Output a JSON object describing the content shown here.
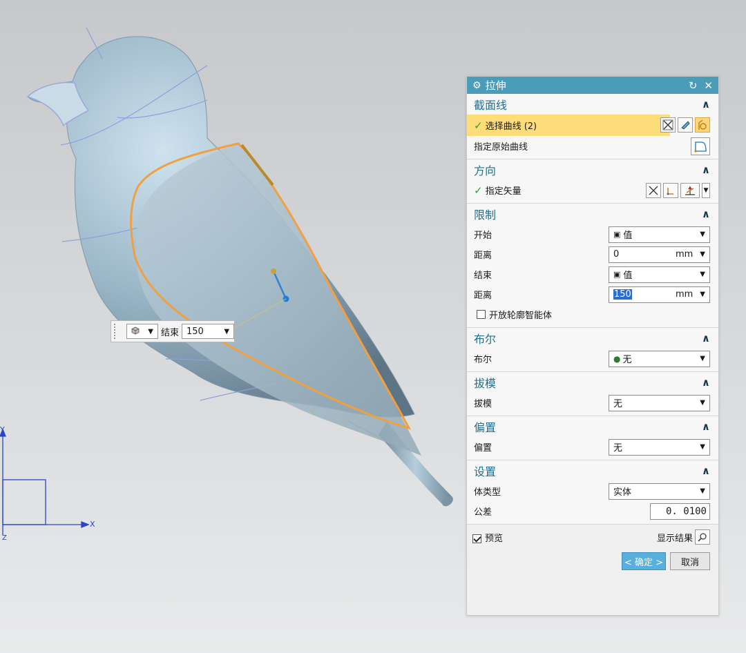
{
  "mini_toolbar": {
    "type_arrow": "▼",
    "label": "结束",
    "value": "150",
    "arrow": "▼"
  },
  "axes": {
    "x_label": "X",
    "y_label": "Y",
    "z_label": "Z"
  },
  "dialog": {
    "title": "拉伸",
    "reset_icon": "↻",
    "close_icon": "✕",
    "sections": {
      "section": {
        "header": "截面线",
        "select_curve": "选择曲线 (2)",
        "original_curve": "指定原始曲线"
      },
      "direction": {
        "header": "方向",
        "vector": "指定矢量"
      },
      "limits": {
        "header": "限制",
        "start_label": "开始",
        "start_value": "值",
        "start_distance_label": "距离",
        "start_distance": "0",
        "start_unit": "mm",
        "end_label": "结束",
        "end_value": "值",
        "end_distance_label": "距离",
        "end_distance": "150",
        "end_unit": "mm",
        "open_profile": "开放轮廓智能体"
      },
      "boolean": {
        "header": "布尔",
        "label": "布尔",
        "value": "无"
      },
      "draft": {
        "header": "拔模",
        "label": "拔模",
        "value": "无"
      },
      "offset": {
        "header": "偏置",
        "label": "偏置",
        "value": "无"
      },
      "settings": {
        "header": "设置",
        "body_type_label": "体类型",
        "body_type": "实体",
        "tolerance_label": "公差",
        "tolerance": "0. 0100"
      }
    },
    "preview_label": "预览",
    "show_result": "显示结果",
    "ok_button": "< 确定 >",
    "cancel_button": "取消"
  },
  "colors": {
    "title_bar": "#4a9cb8",
    "section_header_text": "#1f6f8b",
    "highlight_row": "#fddc7a",
    "model_body": "#9cb8c9",
    "selected_curve": "#f0a040",
    "ok_button": "#5ab0dd"
  }
}
